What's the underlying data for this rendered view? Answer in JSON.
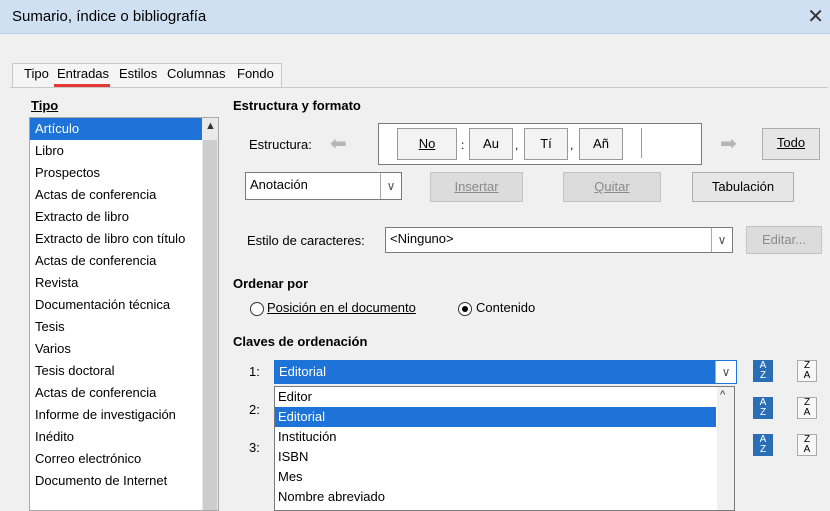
{
  "window": {
    "title": "Sumario, índice o bibliografía",
    "close": "✕"
  },
  "tabs": [
    "Tipo",
    "Entradas",
    "Estilos",
    "Columnas",
    "Fondo"
  ],
  "type_section": {
    "header": "Tipo",
    "items": [
      "Artículo",
      "Libro",
      "Prospectos",
      "Actas de conferencia",
      "Extracto de libro",
      "Extracto de libro con título",
      "Actas de conferencia",
      "Revista",
      "Documentación técnica",
      "Tesis",
      "Varios",
      "Tesis doctoral",
      "Actas de conferencia",
      "Informe de investigación",
      "Inédito",
      "Correo electrónico",
      "Documento de Internet"
    ],
    "selected_index": 0
  },
  "structure": {
    "header": "Estructura y formato",
    "label": "Estructura:",
    "tokens": [
      "No",
      "Au",
      "Tí",
      "Añ"
    ],
    "separators": [
      ":",
      ",",
      ",",
      ""
    ],
    "all_button": "Todo",
    "field_combo": "Anotación",
    "insert_button": "Insertar",
    "remove_button": "Quitar",
    "tab_button": "Tabulación",
    "char_style_label": "Estilo de caracteres:",
    "char_style_value": "<Ninguno>",
    "edit_button": "Editar..."
  },
  "sort": {
    "header": "Ordenar por",
    "option_position": "Posición en el documento",
    "option_content": "Contenido",
    "selected": "content",
    "keys_header": "Claves de ordenación",
    "key_labels": [
      "1:",
      "2:",
      "3:"
    ],
    "key1_value": "Editorial",
    "dropdown_items": [
      "Editor",
      "Editorial",
      "Institución",
      "ISBN",
      "Mes",
      "Nombre abreviado"
    ],
    "dropdown_selected_index": 1
  },
  "colors": {
    "accent": "#1e73d8",
    "tab_underline": "#e53935",
    "titlebar": "#cfe0f3"
  }
}
